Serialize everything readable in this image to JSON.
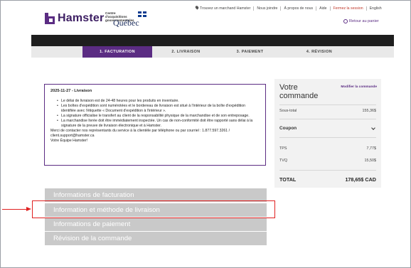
{
  "header": {
    "brand": "Hamster",
    "gov_line": "Centre d'acquisitions gouvernementales",
    "gov_name": "Québec",
    "top_links": [
      "Trouvez un marchand Hamster",
      "Nous joindre",
      "À propos de nous",
      "Aide",
      "Fermez la session",
      "English"
    ],
    "cart_label": "Retour au panier"
  },
  "steps": [
    {
      "label": "1. FACTURATION",
      "active": true
    },
    {
      "label": "2. LIVRAISON",
      "active": false
    },
    {
      "label": "3. PAIEMENT",
      "active": false
    },
    {
      "label": "4. RÉVISION",
      "active": false
    }
  ],
  "message": {
    "title": "2025-11-27 - Livraison",
    "bullets": [
      "Le délai de livraison est de 24-48 heures pour les produits en inventaire.",
      "Les boîtes d'expédition sont numérotées et le bordereau de livraison est situé à l'intérieur de la boîte d'expédition identifiée avec l'étiquette « Document d'expédition à l'intérieur ».",
      "La signature officialise le transfert au client de la responsabilité physique de la marchandise et de son entreposage.",
      "La marchandise livrée doit être immédiatement inspectée. Un cas de non-conformité doit être rapporté sans délai à la signature de la preuve de livraison électronique et à Hamster."
    ],
    "contact": "Merci de contacter nos représentants du service à la clientèle par téléphone ou par courriel : 1.877.597.3261 / client.support@hamster.ca",
    "signature": "Votre Équipe Hamster!"
  },
  "sections": [
    "Informations de facturation",
    "Information et méthode de livraison",
    "Informations de paiement",
    "Révision de la commande"
  ],
  "order": {
    "title": "Votre commande",
    "modify": "Modifier la commande",
    "subtotal_label": "Sous-total",
    "subtotal": "155,36$",
    "coupon_label": "Coupon",
    "tps_label": "TPS",
    "tps": "7,77$",
    "tvq_label": "TVQ",
    "tvq": "15,50$",
    "total_label": "TOTAL",
    "total": "178,65$ CAD"
  },
  "colors": {
    "brand_purple": "#5b2c83",
    "highlight_red": "#e02020",
    "accordion_gray": "#c9c9c9"
  }
}
